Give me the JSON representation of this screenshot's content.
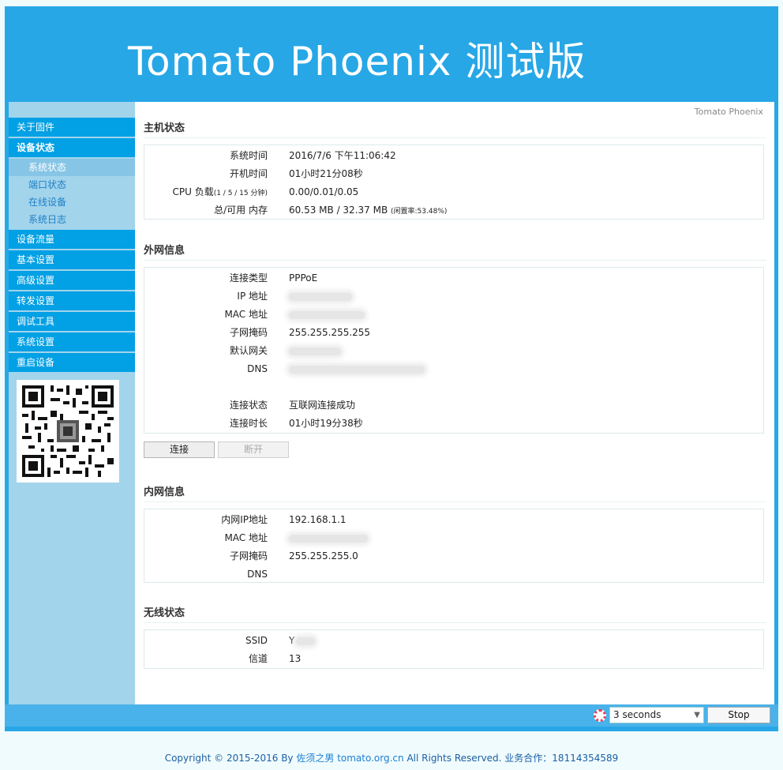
{
  "banner": {
    "title": "Tomato Phoenix  测试版"
  },
  "sidebar": {
    "items": [
      {
        "label": "关于固件"
      },
      {
        "label": "设备状态"
      },
      {
        "label": "设备流量"
      },
      {
        "label": "基本设置"
      },
      {
        "label": "高级设置"
      },
      {
        "label": "转发设置"
      },
      {
        "label": "调试工具"
      },
      {
        "label": "系统设置"
      },
      {
        "label": "重启设备"
      }
    ],
    "subitems": [
      {
        "label": "系统状态"
      },
      {
        "label": "端口状态"
      },
      {
        "label": "在线设备"
      },
      {
        "label": "系统日志"
      }
    ]
  },
  "content": {
    "brand": "Tomato Phoenix",
    "host": {
      "title": "主机状态",
      "system_time_label": "系统时间",
      "system_time": "2016/7/6 下午11:06:42",
      "uptime_label": "开机时间",
      "uptime": "01小时21分08秒",
      "cpu_label": "CPU 负载",
      "cpu_label_suffix": "(1 / 5 / 15 分钟)",
      "cpu": "0.00/0.01/0.05",
      "mem_label": "总/可用 内存",
      "mem": "60.53 MB / 32.37 MB",
      "mem_suffix": "(闲置率:53.48%)"
    },
    "wan": {
      "title": "外网信息",
      "conn_type_label": "连接类型",
      "conn_type": "PPPoE",
      "ip_label": "IP 地址",
      "mac_label": "MAC 地址",
      "netmask_label": "子网掩码",
      "netmask": "255.255.255.255",
      "gateway_label": "默认网关",
      "dns_label": "DNS",
      "status_label": "连接状态",
      "status": "互联网连接成功",
      "duration_label": "连接时长",
      "duration": "01小时19分38秒",
      "connect_label": "连接",
      "disconnect_label": "断开"
    },
    "lan": {
      "title": "内网信息",
      "ip_label": "内网IP地址",
      "ip": "192.168.1.1",
      "mac_label": "MAC 地址",
      "netmask_label": "子网掩码",
      "netmask": "255.255.255.0",
      "dns_label": "DNS"
    },
    "wireless": {
      "title": "无线状态",
      "ssid_label": "SSID",
      "ssid": "Y",
      "channel_label": "信道",
      "channel": "13"
    }
  },
  "bottombar": {
    "interval": "3 seconds",
    "stop_label": "Stop"
  },
  "footer": {
    "prefix": "Copyright © 2015-2016 By ",
    "author": "佐须之男",
    "site": "tomato.org.cn",
    "suffix": " All Rights Reserved. 业务合作：18114354589"
  },
  "colors": {
    "banner": "#27a7e6",
    "nav": "#02a0e4",
    "sidebar": "#a2d4ec",
    "bottombar": "#4ab2ea"
  }
}
